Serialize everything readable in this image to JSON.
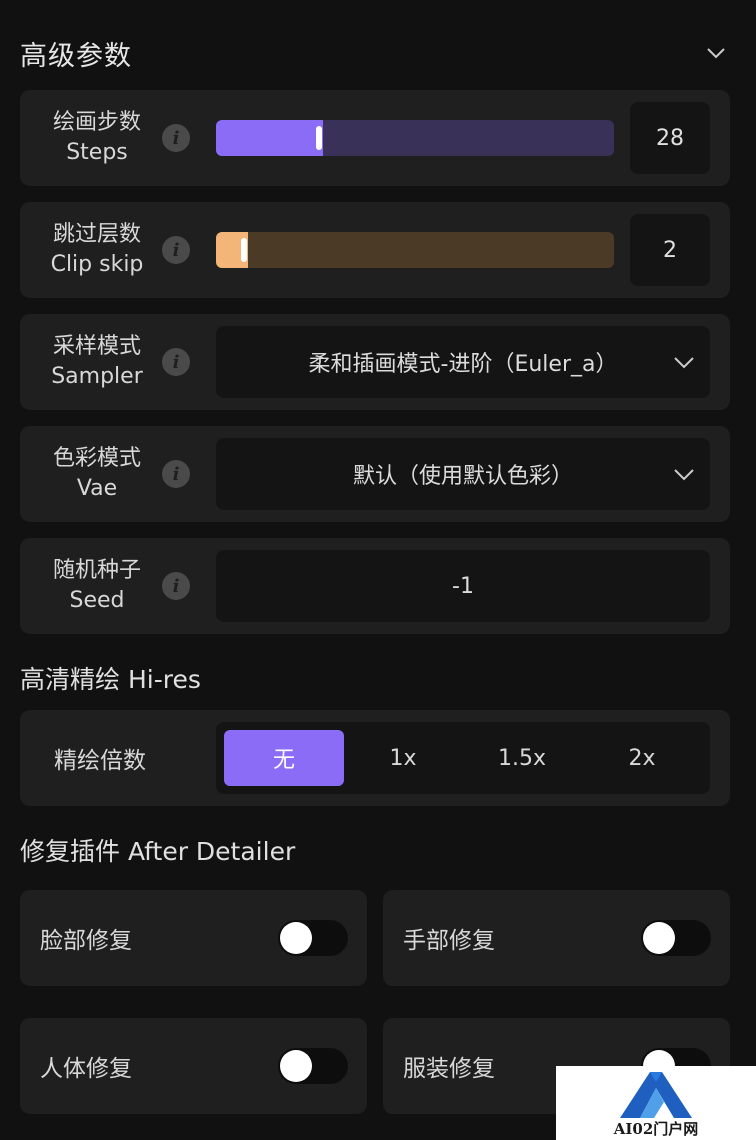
{
  "header": {
    "title": "高级参数",
    "collapse_icon": "chevron-down-icon"
  },
  "params": [
    {
      "label_cn": "绘画步数",
      "label_en": "Steps",
      "control": "slider",
      "value": "28",
      "fill_percent": 27,
      "fill_color": "#8b6cf6",
      "track_color": "#3a3158"
    },
    {
      "label_cn": "跳过层数",
      "label_en": "Clip skip",
      "control": "slider",
      "value": "2",
      "fill_percent": 8,
      "fill_color": "#f4b678",
      "track_color": "#4b3a25"
    },
    {
      "label_cn": "采样模式",
      "label_en": "Sampler",
      "control": "select",
      "value": "柔和插画模式-进阶（Euler_a）"
    },
    {
      "label_cn": "色彩模式",
      "label_en": "Vae",
      "control": "select",
      "value": "默认（使用默认色彩）"
    },
    {
      "label_cn": "随机种子",
      "label_en": "Seed",
      "control": "input",
      "value": "-1"
    }
  ],
  "hires": {
    "title": "高清精绘 Hi-res",
    "label": "精绘倍数",
    "options": [
      "无",
      "1x",
      "1.5x",
      "2x"
    ],
    "selected": "无",
    "accent": "#8b6cf6"
  },
  "detailer": {
    "title": "修复插件 After Detailer",
    "toggles": [
      {
        "label": "脸部修复",
        "on": false
      },
      {
        "label": "手部修复",
        "on": false
      },
      {
        "label": "人体修复",
        "on": false
      },
      {
        "label": "服装修复",
        "on": false
      }
    ]
  },
  "watermark": {
    "text": "AI02门户网"
  }
}
